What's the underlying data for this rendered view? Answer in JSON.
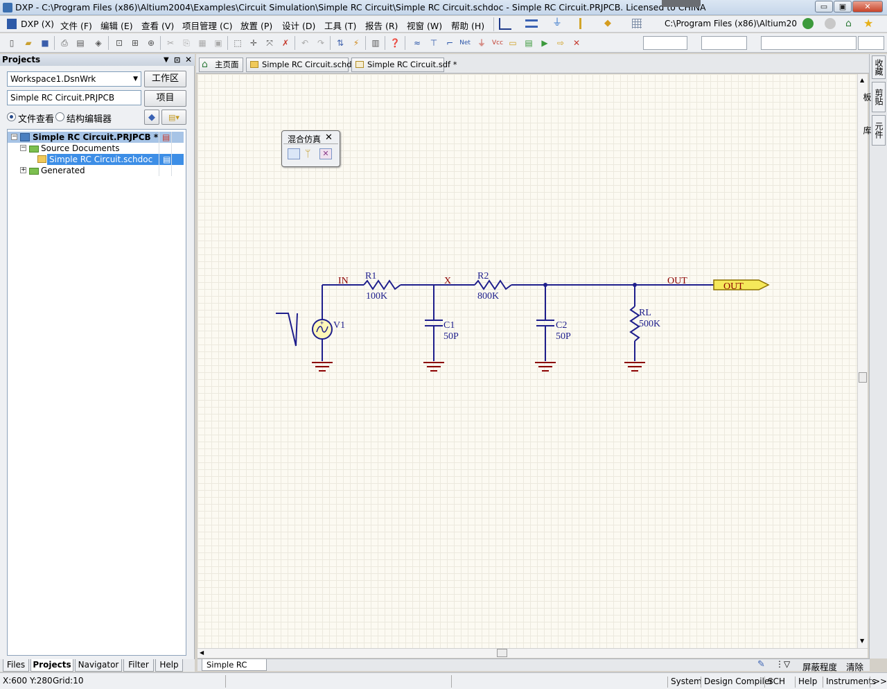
{
  "title_bar": {
    "title": "DXP - C:\\Program Files (x86)\\Altium2004\\Examples\\Circuit Simulation\\Simple RC Circuit\\Simple RC Circuit.schdoc - Simple RC Circuit.PRJPCB. Licensed to CHINA",
    "min_glyph": "▭",
    "max_glyph": "▣",
    "close_glyph": "✕"
  },
  "menu": {
    "items": [
      "DXP (X)",
      "文件 (F)",
      "编辑 (E)",
      "查看 (V)",
      "项目管理 (C)",
      "放置 (P)",
      "设计 (D)",
      "工具 (T)",
      "报告 (R)",
      "视窗 (W)",
      "帮助 (H)"
    ],
    "path_combo": "C:\\Program Files (x86)\\Altium20"
  },
  "panel": {
    "header": "Projects",
    "workspace_value": "Workspace1.DsnWrk",
    "workspace_button": "工作区",
    "project_value": "Simple RC Circuit.PRJPCB",
    "project_button": "项目",
    "radio_file_view": "文件查看",
    "radio_structure_editor": "结构编辑器",
    "tree": {
      "project": "Simple RC Circuit.PRJPCB *",
      "source_folder": "Source Documents",
      "schdoc": "Simple RC Circuit.schdoc",
      "generated": "Generated"
    },
    "bottom_tabs": [
      "Files",
      "Projects",
      "Navigator",
      "Filter",
      "Help"
    ]
  },
  "doc_tabs": [
    "主页面",
    "Simple RC Circuit.schdoc",
    "Simple RC Circuit.sdf *"
  ],
  "right_tabs": [
    "收藏",
    "剪贴板",
    "元件库"
  ],
  "sim_toolbar": {
    "title": "混合仿真",
    "close": "✕"
  },
  "schematic": {
    "wire_color": "#1e1e8c",
    "label_color": "#1e1e8c",
    "net_color": "#8b0000",
    "ground_color": "#8b0000",
    "nets": [
      "IN",
      "X",
      "OUT"
    ],
    "port": "OUT",
    "components": [
      {
        "ref": "R1",
        "value": "100K"
      },
      {
        "ref": "R2",
        "value": "800K"
      },
      {
        "ref": "C1",
        "value": "50P"
      },
      {
        "ref": "C2",
        "value": "50P"
      },
      {
        "ref": "RL",
        "value": "500K"
      },
      {
        "ref": "V1",
        "value": ""
      }
    ]
  },
  "sheet_tab": "Simple RC Circuit",
  "sheet_bar_right": {
    "mask": "屏蔽程度",
    "clear": "清除"
  },
  "status": {
    "coords": "X:600 Y:280",
    "grid": "Grid:10",
    "buttons": [
      "System",
      "Design Compiler",
      "SCH",
      "Help",
      "Instruments",
      ">>"
    ]
  }
}
